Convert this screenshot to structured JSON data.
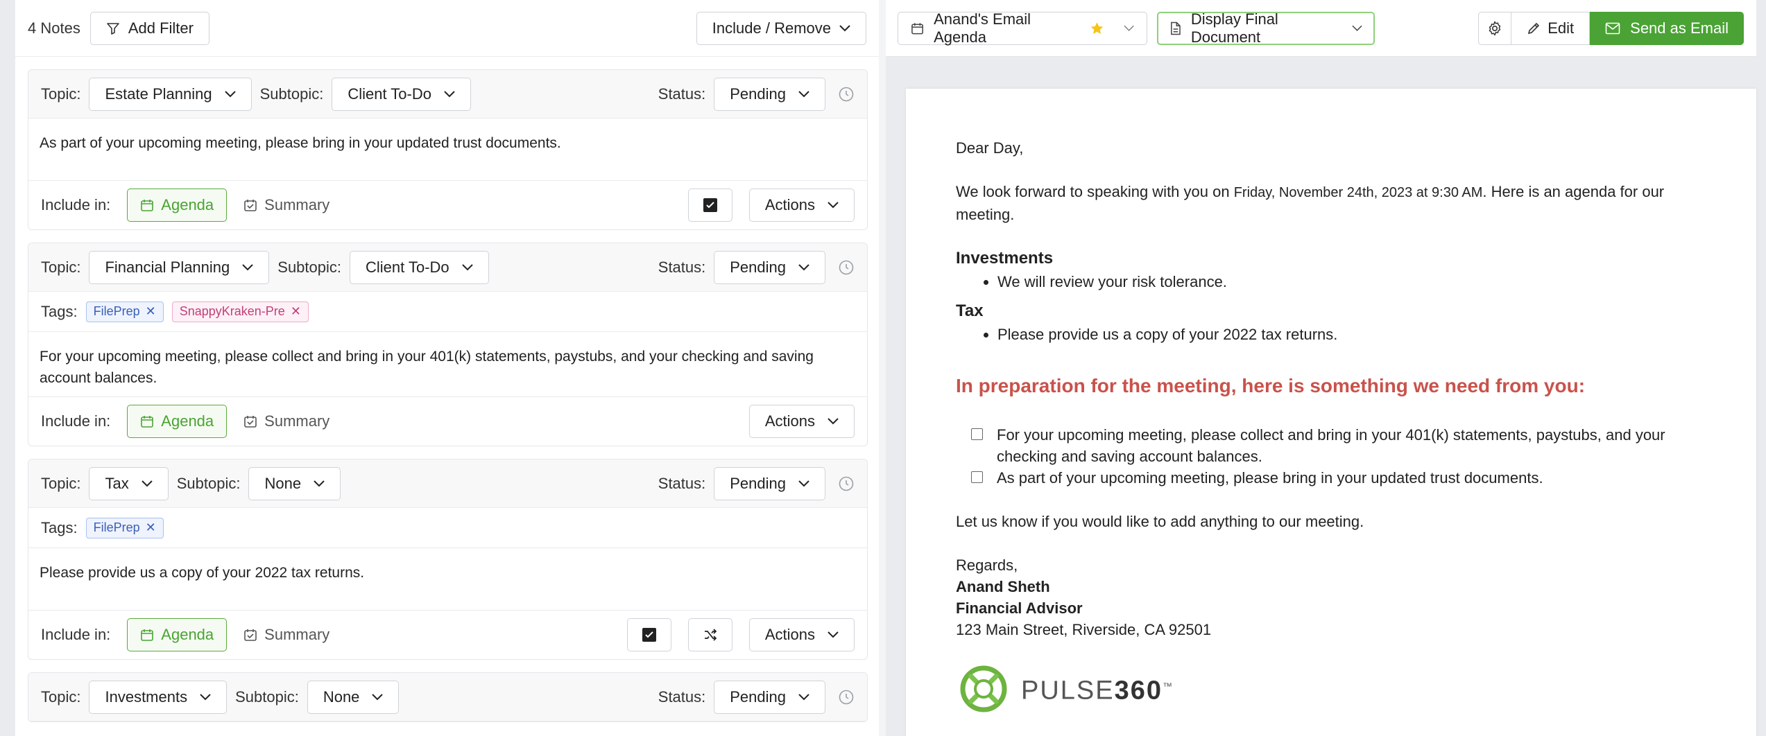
{
  "left_toolbar": {
    "notes_count": "4 Notes",
    "add_filter_label": "Add Filter",
    "include_remove_label": "Include / Remove"
  },
  "labels": {
    "topic": "Topic:",
    "subtopic": "Subtopic:",
    "status": "Status:",
    "tags": "Tags:",
    "include_in": "Include in:",
    "agenda": "Agenda",
    "summary": "Summary",
    "actions": "Actions"
  },
  "notes": [
    {
      "topic": "Estate Planning",
      "subtopic": "Client To-Do",
      "status": "Pending",
      "tags": [],
      "body": "As part of your upcoming meeting, please bring in your updated trust documents."
    },
    {
      "topic": "Financial Planning",
      "subtopic": "Client To-Do",
      "status": "Pending",
      "tags": [
        "FilePrep",
        "SnappyKraken-Pre"
      ],
      "body": "For your upcoming meeting, please collect and bring in your 401(k) statements, paystubs, and your checking and saving account balances."
    },
    {
      "topic": "Tax",
      "subtopic": "None",
      "status": "Pending",
      "tags": [
        "FilePrep"
      ],
      "body": "Please provide us a copy of your 2022 tax returns."
    },
    {
      "topic": "Investments",
      "subtopic": "None",
      "status": "Pending"
    }
  ],
  "right_toolbar": {
    "agenda_select": "Anand's Email Agenda",
    "display_select": "Display Final Document",
    "edit_label": "Edit",
    "send_label": "Send as Email"
  },
  "document": {
    "greeting": "Dear Day,",
    "intro_before": "We look forward to speaking with you on ",
    "intro_date": "Friday, November 24th, 2023 at 9:30 AM",
    "intro_after": ". Here is an agenda for our meeting.",
    "sections": [
      {
        "heading": "Investments",
        "items": [
          "We will review your risk tolerance."
        ]
      },
      {
        "heading": "Tax",
        "items": [
          "Please provide us a copy of your 2022 tax returns."
        ]
      }
    ],
    "need_heading": "In preparation for the meeting, here is something we need from you:",
    "checklist": [
      "For your upcoming meeting, please collect and bring in your 401(k) statements, paystubs, and your checking and saving account balances.",
      "As part of your upcoming meeting, please bring in your updated trust documents."
    ],
    "closing": "Let us know if you would like to add anything to our meeting.",
    "regards": "Regards,",
    "signer_name": "Anand Sheth",
    "signer_title": "Financial Advisor",
    "address": "123 Main Street, Riverside, CA 92501",
    "logo_text_light": "PULSE",
    "logo_text_bold": "360",
    "logo_tm": "™"
  },
  "colors": {
    "accent_green": "#4aa334",
    "need_red": "#c9524b"
  }
}
